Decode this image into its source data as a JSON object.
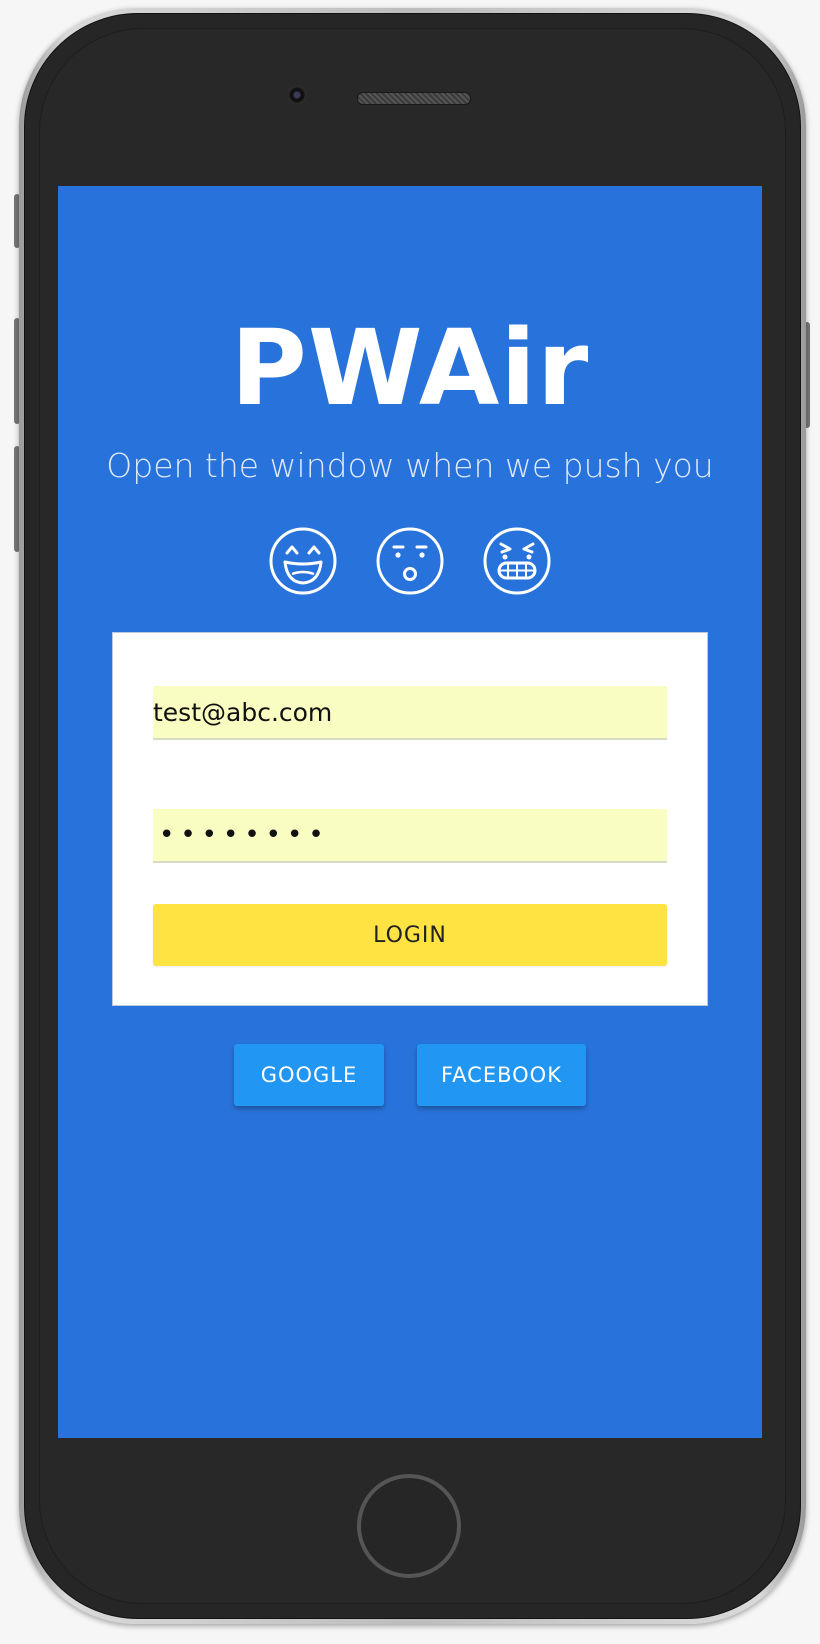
{
  "app": {
    "title": "PWAir",
    "subtitle": "Open the window when we push you"
  },
  "emojis": [
    {
      "icon": "grinning-face-icon"
    },
    {
      "icon": "surprised-face-icon"
    },
    {
      "icon": "angry-grimacing-face-icon"
    }
  ],
  "login_form": {
    "email_value": "test@abc.com",
    "password_value": "••••••••",
    "login_label": "LOGIN"
  },
  "social": {
    "google_label": "GOOGLE",
    "facebook_label": "FACEBOOK"
  },
  "colors": {
    "screen_background": "#2873db",
    "input_background": "#f9fdc1",
    "login_button": "#ffe342",
    "social_button": "#2196f3"
  }
}
